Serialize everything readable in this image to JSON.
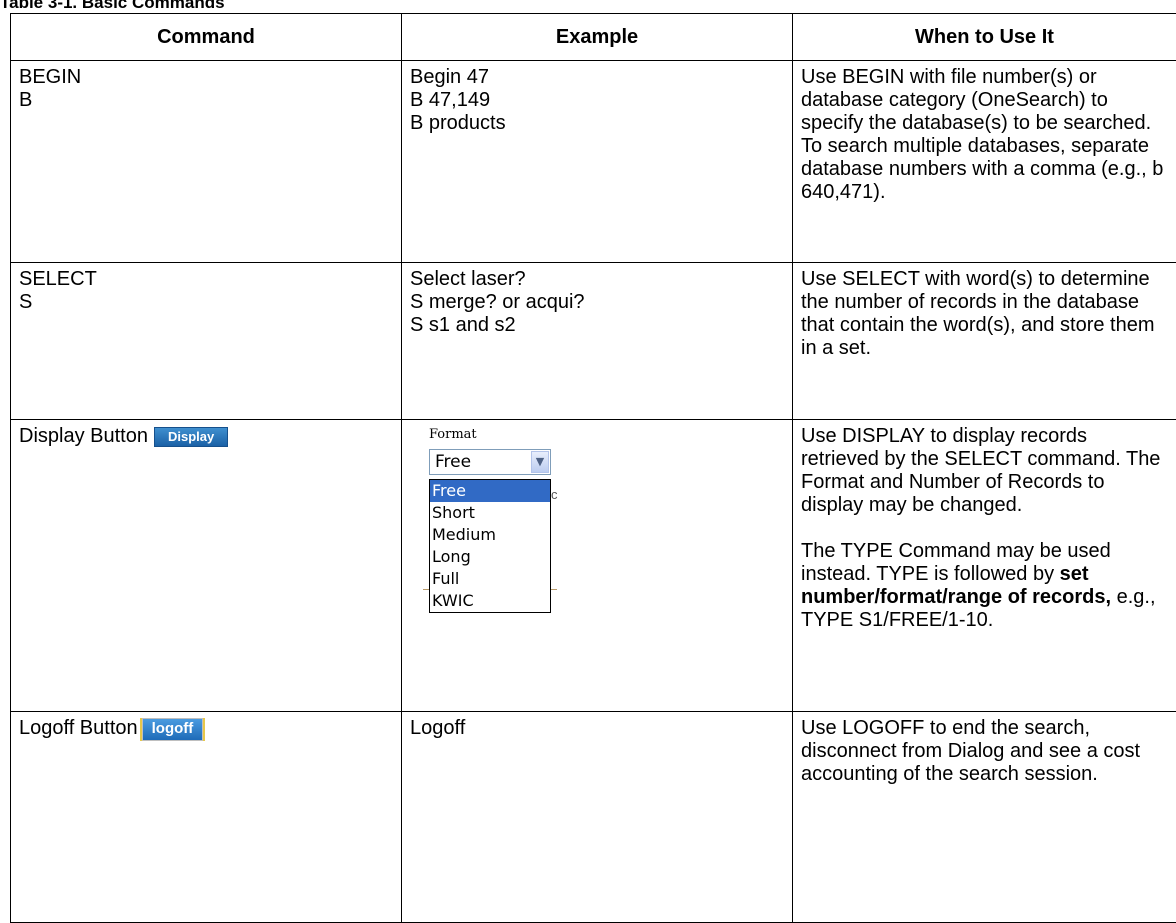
{
  "caption": "Table 3-1. Basic Commands",
  "headers": {
    "command": "Command",
    "example": "Example",
    "when": "When to Use It"
  },
  "rows": {
    "begin": {
      "command": [
        "BEGIN",
        "B"
      ],
      "example": [
        "Begin 47",
        "B 47,149",
        "B products"
      ],
      "when": "Use BEGIN with file number(s) or database category (OneSearch) to specify the database(s) to be searched.  To search multiple databases, separate database numbers with a comma (e.g., b 640,471)."
    },
    "select": {
      "command": [
        "SELECT",
        "S"
      ],
      "example": [
        "Select laser?",
        "S merge? or acqui?",
        "S s1 and s2"
      ],
      "when": "Use SELECT with word(s) to determine the number of records in the database that contain the word(s), and store them in a set."
    },
    "display": {
      "command": "Display Button",
      "button_label": "Display",
      "format_label": "Format",
      "format_selected": "Free",
      "format_options": [
        "Free",
        "Short",
        "Medium",
        "Long",
        "Full",
        "KWIC"
      ],
      "when_p1": "Use DISPLAY to display records retrieved by the SELECT command.  The Format and Number of Records to display may be changed.",
      "when_p2_a": "The TYPE Command may be used instead. TYPE is followed by ",
      "when_p2_bold": "set number/format/range of records,",
      "when_p2_b": " e.g., TYPE S1/FREE/1-10."
    },
    "logoff": {
      "command": "Logoff Button",
      "button_label": "logoff",
      "example": "Logoff",
      "when": "Use LOGOFF to end the search, disconnect from Dialog and see a cost accounting of the search session."
    }
  }
}
